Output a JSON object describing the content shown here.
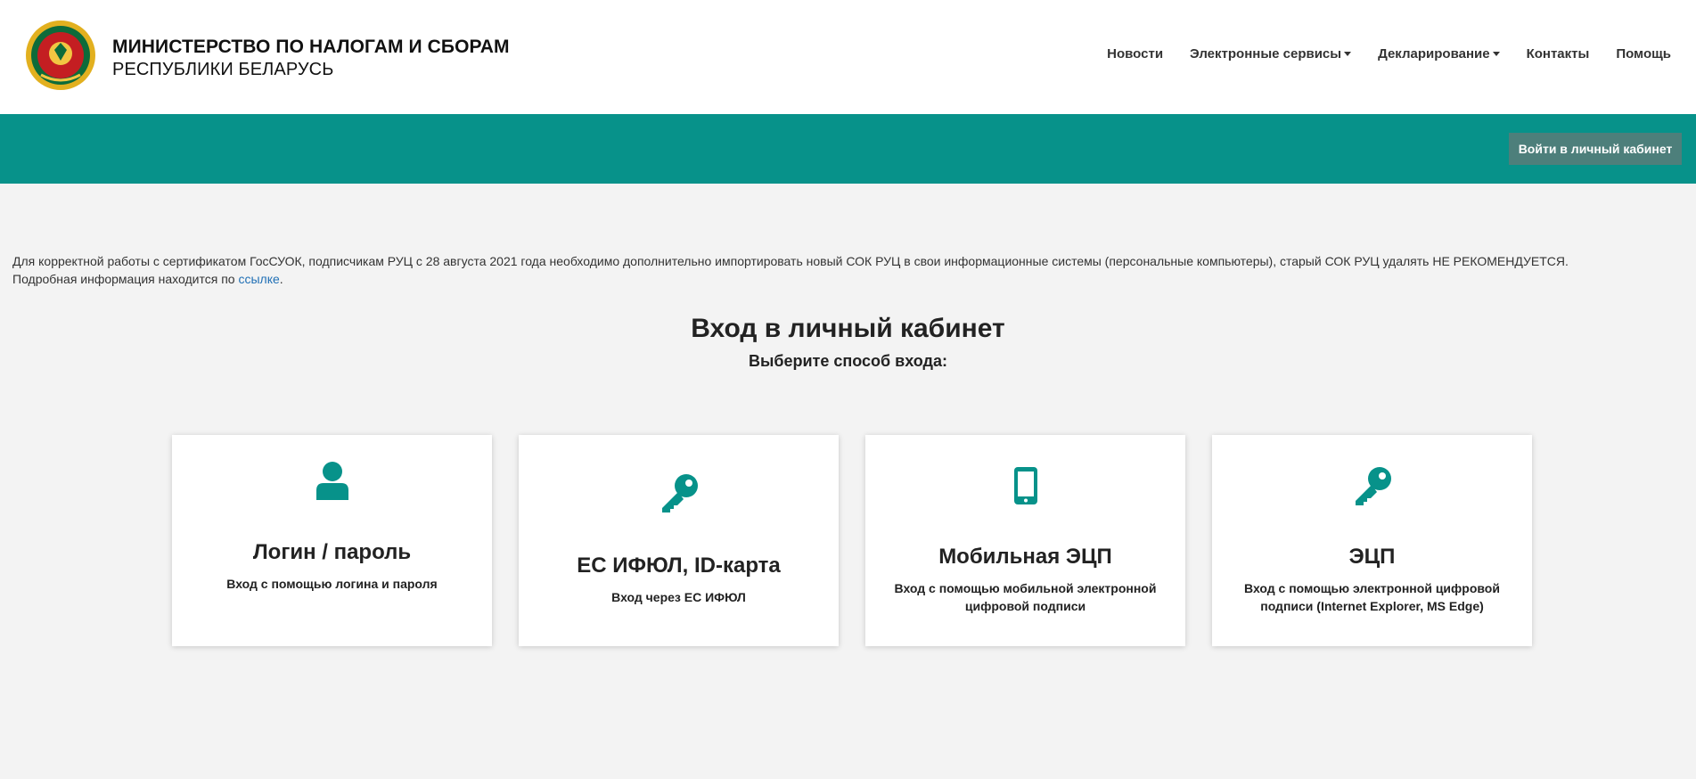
{
  "brand": {
    "line1": "МИНИСТЕРСТВО ПО НАЛОГАМ И СБОРАМ",
    "line2": "РЕСПУБЛИКИ БЕЛАРУСЬ"
  },
  "nav": [
    {
      "label": "Новости"
    },
    {
      "label": "Электронные сервисы"
    },
    {
      "label": "Декларирование"
    },
    {
      "label": "Контакты"
    },
    {
      "label": "Помощь"
    }
  ],
  "band": {
    "login_label": "Войти в личный кабинет"
  },
  "notice": {
    "text1": "Для корректной работы с сертификатом ГосСУОК, подписчикам РУЦ с 28 августа 2021 года необходимо дополнительно импортировать новый СОК РУЦ в свои информационные системы (персональные компьютеры), старый СОК РУЦ удалять НЕ РЕКОМЕНДУЕТСЯ.",
    "text2_prefix": "Подробная информация находится по ",
    "link_label": "ссылке",
    "text2_suffix": "."
  },
  "page": {
    "title": "Вход в личный кабинет",
    "subtitle": "Выберите способ входа:"
  },
  "cards": [
    {
      "icon": "user-icon",
      "title": "Логин / пароль",
      "desc": "Вход с помощью логина и пароля"
    },
    {
      "icon": "key-icon",
      "title": "ЕС ИФЮЛ, ID-карта",
      "desc": "Вход через ЕС ИФЮЛ"
    },
    {
      "icon": "mobile-phone-icon",
      "title": "Мобильная ЭЦП",
      "desc": "Вход с помощью мобильной электронной цифровой подписи"
    },
    {
      "icon": "key-icon",
      "title": "ЭЦП",
      "desc": "Вход с помощью электронной цифровой подписи (Internet Explorer, MS Edge)"
    }
  ],
  "colors": {
    "accent": "#07928a",
    "button": "#4d7f7b",
    "link": "#1f6fb5"
  }
}
